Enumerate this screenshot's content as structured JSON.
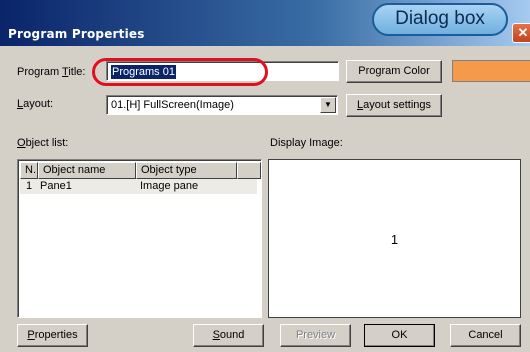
{
  "window": {
    "title": "Program Properties",
    "close_glyph": "✕",
    "callout": "Dialog box"
  },
  "program_title": {
    "label_prefix": "Program ",
    "label_accel": "T",
    "label_suffix": "itle:",
    "value": "Programs 01"
  },
  "program_color": {
    "button_label": "Program Color",
    "swatch_color": "#f49a4a"
  },
  "layout": {
    "label_accel": "L",
    "label_suffix": "ayout:",
    "selected_value": "01.[H] FullScreen(Image)",
    "settings_accel": "L",
    "settings_suffix": "ayout settings"
  },
  "object_list": {
    "label_accel": "O",
    "label_suffix": "bject list:",
    "columns": [
      "N...",
      "Object name",
      "Object type"
    ],
    "rows": [
      {
        "n": "1",
        "name": "Pane1",
        "type": "Image pane"
      }
    ]
  },
  "display_image": {
    "label": "Display Image:",
    "number": "1"
  },
  "buttons": {
    "properties_accel": "P",
    "properties_suffix": "roperties",
    "sound_accel": "S",
    "sound_suffix": "ound",
    "preview": "Preview",
    "ok": "OK",
    "cancel": "Cancel"
  },
  "colors": {
    "highlight_oval": "#e01020",
    "titlebar": "#0a246a",
    "callout_fill": "#8fc4ec"
  }
}
